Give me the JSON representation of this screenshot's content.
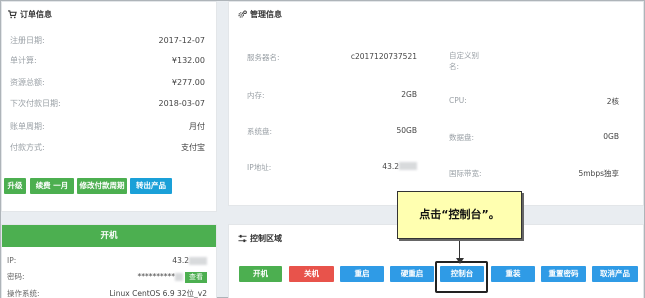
{
  "order": {
    "title": "订单信息",
    "rows": [
      {
        "label": "注册日期:",
        "value": "2017-12-07"
      },
      {
        "label": "单计算:",
        "value": "¥132.00"
      },
      {
        "label": "资源总额:",
        "value": "¥277.00"
      },
      {
        "label": "下次付款日期:",
        "value": "2018-03-07"
      },
      {
        "label": "账单周期:",
        "value": "月付"
      },
      {
        "label": "付款方式:",
        "value": "支付宝"
      }
    ],
    "buttons": [
      "升级",
      "续费 一月",
      "修改付款周期",
      "转出产品"
    ]
  },
  "management": {
    "title": "管理信息",
    "left": [
      {
        "label": "服务器名:",
        "value": "c2017120737521"
      },
      {
        "label": "内存:",
        "value": "2GB"
      },
      {
        "label": "系统盘:",
        "value": "50GB"
      },
      {
        "label": "IP地址:",
        "value": "43.2"
      }
    ],
    "right": [
      {
        "label": "自定义别名:",
        "value": ""
      },
      {
        "label": "CPU:",
        "value": "2核"
      },
      {
        "label": "数据盘:",
        "value": "0GB"
      },
      {
        "label": "国际带宽:",
        "value": "5mbps独享"
      }
    ]
  },
  "power": {
    "status": "开机",
    "ip_label": "IP:",
    "ip_value": "43.2",
    "password_label": "密码:",
    "password_value": "**********",
    "view_label": "查看",
    "os_label": "操作系统:",
    "os_value": "Linux CentOS 6.9 32位_v2"
  },
  "control": {
    "title": "控制区域",
    "buttons": {
      "start": "开机",
      "shutdown": "关机",
      "reboot": "重启",
      "hard_reboot": "硬重启",
      "console": "控制台",
      "reinstall": "重装",
      "reset_password": "重置密码",
      "cancel_product": "取消产品"
    }
  },
  "callout": {
    "text": "点击“控制台”。"
  },
  "colors": {
    "green": "#4caf50",
    "blue": "#2f9be6",
    "red": "#e8534b",
    "callout_bg": "#ffffb0"
  }
}
